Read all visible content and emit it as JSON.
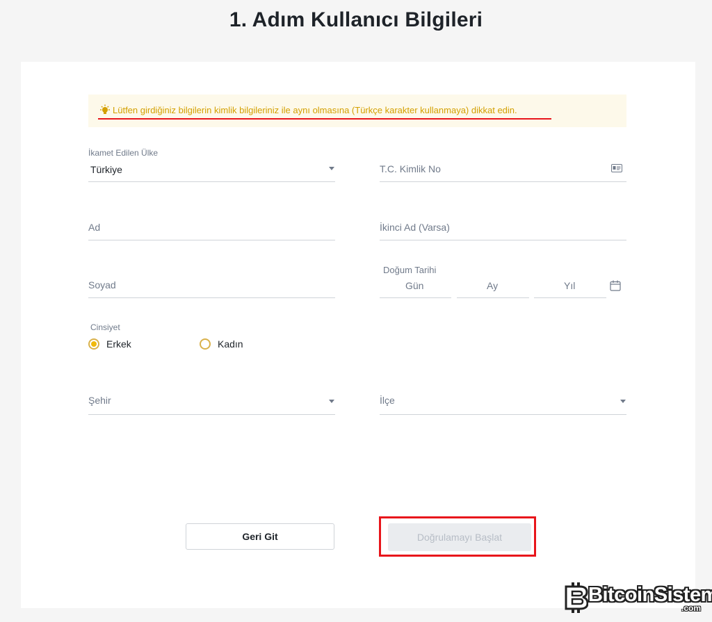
{
  "page": {
    "title": "1. Adım Kullanıcı Bilgileri"
  },
  "notice": {
    "text": "Lütfen girdiğiniz bilgilerin kimlik bilgileriniz ile aynı olmasına (Türkçe karakter kullanmaya) dikkat edin.",
    "icon": "lightbulb-icon",
    "color": "#d4a000",
    "background": "#fdf9ea"
  },
  "form": {
    "country": {
      "label": "İkamet Edilen Ülke",
      "value": "Türkiye"
    },
    "tc_id": {
      "placeholder": "T.C. Kimlik No",
      "icon": "id-card-icon"
    },
    "first_name": {
      "placeholder": "Ad"
    },
    "middle_name": {
      "placeholder": "İkinci Ad (Varsa)"
    },
    "last_name": {
      "placeholder": "Soyad"
    },
    "birth_date": {
      "label": "Doğum Tarihi",
      "day_placeholder": "Gün",
      "month_placeholder": "Ay",
      "year_placeholder": "Yıl",
      "icon": "calendar-icon"
    },
    "gender": {
      "label": "Cinsiyet",
      "options": [
        {
          "label": "Erkek",
          "selected": true
        },
        {
          "label": "Kadın",
          "selected": false
        }
      ]
    },
    "city": {
      "placeholder": "Şehir"
    },
    "district": {
      "placeholder": "İlçe"
    }
  },
  "actions": {
    "back_label": "Geri Git",
    "start_label": "Doğrulamayı Başlat"
  },
  "watermark": {
    "text": "BitcoinSistemi",
    "suffix": ".com"
  },
  "colors": {
    "accent": "#f0b90b",
    "highlight": "#e8151b"
  }
}
